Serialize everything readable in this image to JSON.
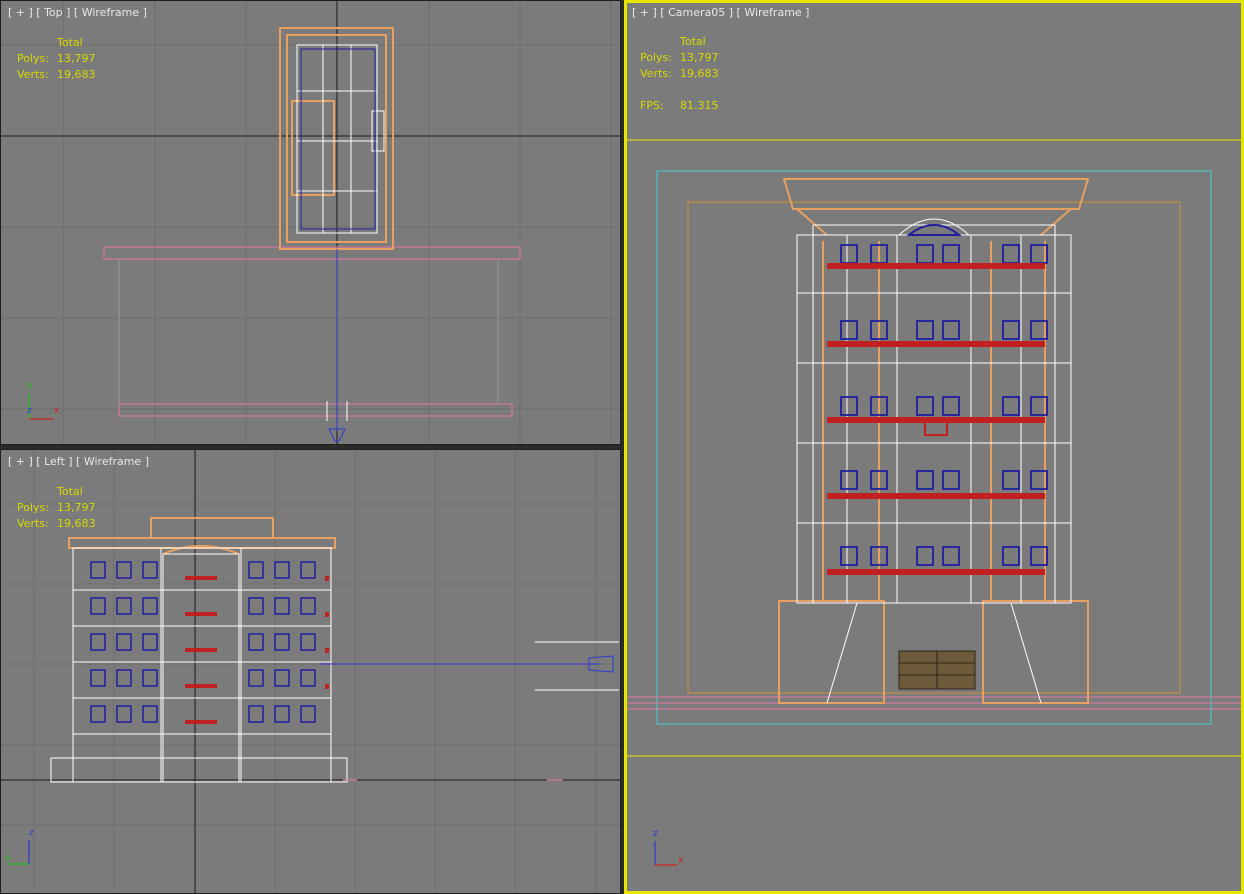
{
  "colors": {
    "viewport_bg": "#7b7b7b",
    "grid_line": "#6c6c6c",
    "grid_axis": "#1a1a1a",
    "stats_text": "#d9d900",
    "active_border": "#e6e600",
    "wire_white": "#ffffff",
    "wire_orange": "#e8a060",
    "wire_blue": "#1f1fa0",
    "wire_red": "#c02020",
    "wire_pink": "#e37aa7",
    "safe_cyan": "#40d0d0",
    "safe_orange": "#d09030"
  },
  "viewports": {
    "top": {
      "label": "[ + ] [ Top ] [ Wireframe ]",
      "stats": {
        "header": "Total",
        "polys_label": "Polys:",
        "polys": "13,797",
        "verts_label": "Verts:",
        "verts": "19,683"
      },
      "axes": [
        "y",
        "z",
        "x"
      ]
    },
    "left": {
      "label": "[ + ] [ Left ] [ Wireframe ]",
      "stats": {
        "header": "Total",
        "polys_label": "Polys:",
        "polys": "13,797",
        "verts_label": "Verts:",
        "verts": "19,683"
      },
      "axes": [
        "z",
        "y"
      ]
    },
    "camera": {
      "label": "[ + ] [ Camera05 ] [ Wireframe ]",
      "stats": {
        "header": "Total",
        "polys_label": "Polys:",
        "polys": "13,797",
        "verts_label": "Verts:",
        "verts": "19,683",
        "fps_label": "FPS:",
        "fps": "81.315"
      },
      "axes": [
        "z",
        "x"
      ]
    }
  }
}
